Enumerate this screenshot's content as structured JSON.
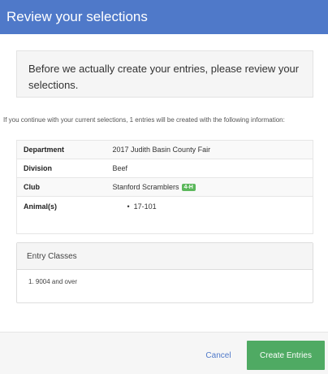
{
  "modal": {
    "title": "Review your selections"
  },
  "alert": {
    "text": "Before we actually create your entries, please review your selections."
  },
  "intro": {
    "text": "If you continue with your current selections, 1 entries will be created with the following information:"
  },
  "details": {
    "rows": [
      {
        "label": "Department",
        "value": "2017 Judith Basin County Fair"
      },
      {
        "label": "Division",
        "value": "Beef"
      },
      {
        "label": "Club",
        "value": "Stanford Scramblers",
        "badge": "4-H"
      },
      {
        "label": "Animal(s)",
        "items": [
          "17-101"
        ]
      }
    ]
  },
  "entry_classes": {
    "heading": "Entry Classes",
    "items": [
      "1. 9004 and over"
    ]
  },
  "footer": {
    "cancel_label": "Cancel",
    "create_label": "Create Entries"
  },
  "colors": {
    "header": "#4f79c9",
    "badge": "#5cb85c",
    "create_button": "#4faa63",
    "link": "#4f79c9"
  },
  "bullet_glyph": "•"
}
